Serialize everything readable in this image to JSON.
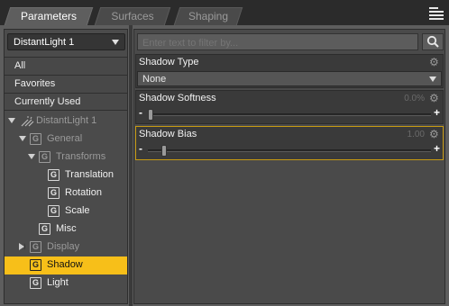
{
  "tabs": [
    {
      "label": "Parameters",
      "active": true
    },
    {
      "label": "Surfaces",
      "active": false
    },
    {
      "label": "Shaping",
      "active": false
    }
  ],
  "node_selector": {
    "value": "DistantLight 1"
  },
  "filters": [
    {
      "label": "All"
    },
    {
      "label": "Favorites"
    },
    {
      "label": "Currently Used"
    }
  ],
  "tree": [
    {
      "label": "DistantLight 1",
      "icon": "distant-light-icon",
      "expanded": true,
      "dim": true
    },
    {
      "label": "General",
      "icon": "group-icon",
      "expanded": true,
      "dim": true
    },
    {
      "label": "Transforms",
      "icon": "group-icon",
      "expanded": true,
      "dim": true
    },
    {
      "label": "Translation",
      "icon": "group-icon",
      "dim": false
    },
    {
      "label": "Rotation",
      "icon": "group-icon",
      "dim": false
    },
    {
      "label": "Scale",
      "icon": "group-icon",
      "dim": false
    },
    {
      "label": "Misc",
      "icon": "group-icon",
      "dim": false
    },
    {
      "label": "Display",
      "icon": "group-icon",
      "expanded": false,
      "dim": true
    },
    {
      "label": "Shadow",
      "icon": "group-icon",
      "selected": true
    },
    {
      "label": "Light",
      "icon": "group-icon",
      "dim": false
    }
  ],
  "group_icon_glyph": "G",
  "search": {
    "placeholder": "Enter text to filter by..."
  },
  "properties": [
    {
      "title": "Shadow Type",
      "control": "dropdown",
      "value": "None"
    },
    {
      "title": "Shadow Softness",
      "control": "slider",
      "value": "0.0%",
      "fraction": 0.0
    },
    {
      "title": "Shadow Bias",
      "control": "slider",
      "value": "1.00",
      "fraction": 0.05
    }
  ],
  "colors": {
    "selection": "#f7bf19",
    "highlight_border": "#c79a12"
  }
}
